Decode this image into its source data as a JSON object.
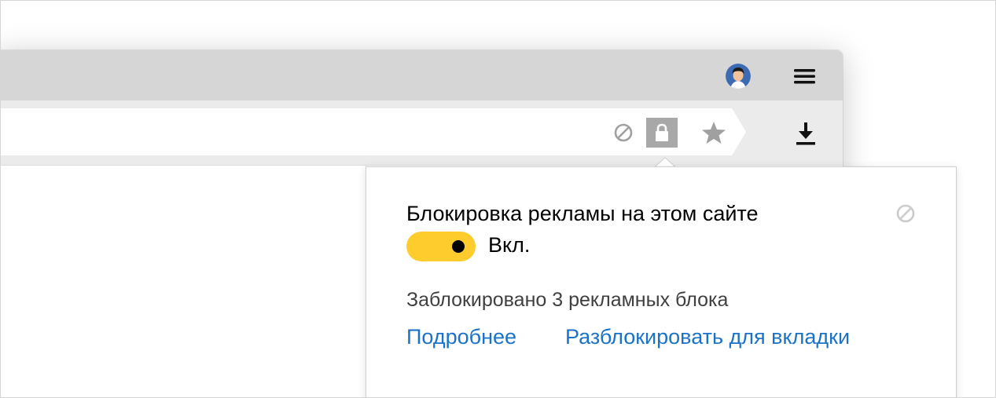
{
  "browser": {
    "title_bar": {
      "avatar_icon": "user-avatar-icon",
      "menu_icon": "hamburger-menu-icon"
    },
    "address_bar": {
      "icons": [
        "ad-block-icon",
        "lock-icon",
        "star-icon"
      ],
      "download_icon": "download-icon"
    }
  },
  "popup": {
    "title": "Блокировка рекламы на этом сайте",
    "toggle": {
      "state": "on",
      "label": "Вкл.",
      "color": "#fecc2d"
    },
    "blocked_text": "Заблокировано 3 рекламных блока",
    "links": {
      "more": "Подробнее",
      "unblock": "Разблокировать для вкладки"
    },
    "link_color": "#1a73c8",
    "corner_icon": "ad-block-icon"
  }
}
